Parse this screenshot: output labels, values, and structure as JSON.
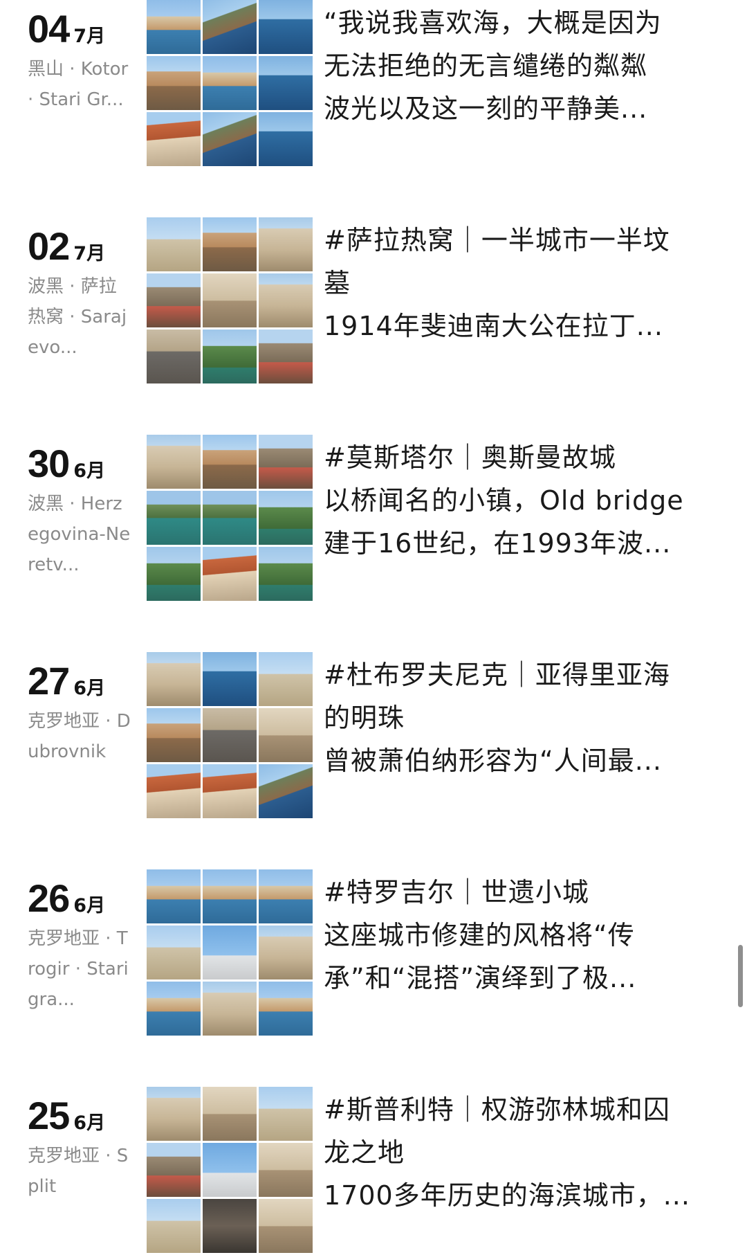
{
  "entries": [
    {
      "day": "04",
      "month": "7月",
      "place": "黑山 · Kotor · Stari Gr...",
      "caption": [
        "“我说我喜欢海，大概是因为",
        "无法拒绝的无言缱绻的粼粼",
        "波光以及这一刻的平静美..."
      ]
    },
    {
      "day": "02",
      "month": "7月",
      "place": "波黑 · 萨拉热窝 · Sarajevo...",
      "caption": [
        "#萨拉热窝｜一半城市一半坟",
        "墓",
        "1914年斐迪南大公在拉丁..."
      ]
    },
    {
      "day": "30",
      "month": "6月",
      "place": "波黑 · Herzegovina-Neretv...",
      "caption": [
        "#莫斯塔尔｜奥斯曼故城",
        "以桥闻名的小镇，Old bridge",
        "建于16世纪，在1993年波..."
      ]
    },
    {
      "day": "27",
      "month": "6月",
      "place": "克罗地亚 · Dubrovnik",
      "caption": [
        "#杜布罗夫尼克｜亚得里亚海",
        "的明珠",
        "曾被萧伯纳形容为“人间最..."
      ]
    },
    {
      "day": "26",
      "month": "6月",
      "place": "克罗地亚 · Trogir · Stari gra...",
      "caption": [
        "#特罗吉尔｜世遗小城",
        "这座城市修建的风格将“传",
        "承”和“混搭”演绎到了极..."
      ]
    },
    {
      "day": "25",
      "month": "6月",
      "place": "克罗地亚 · Split",
      "caption": [
        "#斯普利特｜权游弥林城和囚",
        "龙之地",
        "1700多年历史的海滨城市，..."
      ]
    }
  ]
}
